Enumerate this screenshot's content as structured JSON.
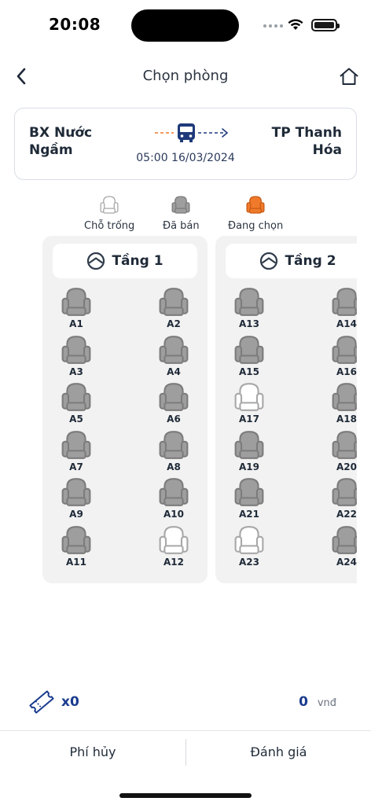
{
  "status": {
    "time": "20:08"
  },
  "header": {
    "title": "Chọn phòng"
  },
  "trip": {
    "origin": "BX Nước Ngầm",
    "destination": "TP Thanh Hóa",
    "departure": "05:00 16/03/2024"
  },
  "legend": [
    {
      "state": "empty",
      "label": "Chỗ trống"
    },
    {
      "state": "sold",
      "label": "Đã bán"
    },
    {
      "state": "selected",
      "label": "Đang chọn"
    }
  ],
  "colors": {
    "sold": "#9e9e9e",
    "empty": "#ffffff",
    "selected": "#f07a2b",
    "accent": "#1a3c8f",
    "route_orange": "#f07a2b",
    "route_navy": "#1f3a7a"
  },
  "floors": [
    {
      "name": "Tầng 1",
      "seats": [
        {
          "code": "A1",
          "state": "sold"
        },
        {
          "code": "A2",
          "state": "sold"
        },
        {
          "code": "A3",
          "state": "sold"
        },
        {
          "code": "A4",
          "state": "sold"
        },
        {
          "code": "A5",
          "state": "sold"
        },
        {
          "code": "A6",
          "state": "sold"
        },
        {
          "code": "A7",
          "state": "sold"
        },
        {
          "code": "A8",
          "state": "sold"
        },
        {
          "code": "A9",
          "state": "sold"
        },
        {
          "code": "A10",
          "state": "sold"
        },
        {
          "code": "A11",
          "state": "sold"
        },
        {
          "code": "A12",
          "state": "empty"
        }
      ]
    },
    {
      "name": "Tầng 2",
      "seats": [
        {
          "code": "A13",
          "state": "sold"
        },
        {
          "code": "A14",
          "state": "sold"
        },
        {
          "code": "A15",
          "state": "sold"
        },
        {
          "code": "A16",
          "state": "sold"
        },
        {
          "code": "A17",
          "state": "empty"
        },
        {
          "code": "A18",
          "state": "sold"
        },
        {
          "code": "A19",
          "state": "sold"
        },
        {
          "code": "A20",
          "state": "sold"
        },
        {
          "code": "A21",
          "state": "sold"
        },
        {
          "code": "A22",
          "state": "sold"
        },
        {
          "code": "A23",
          "state": "empty"
        },
        {
          "code": "A24",
          "state": "sold"
        }
      ]
    }
  ],
  "summary": {
    "tickets": "x0",
    "price": "0",
    "currency": "vnđ"
  },
  "bottom": {
    "cancel_fee": "Phí hủy",
    "review": "Đánh giá"
  }
}
